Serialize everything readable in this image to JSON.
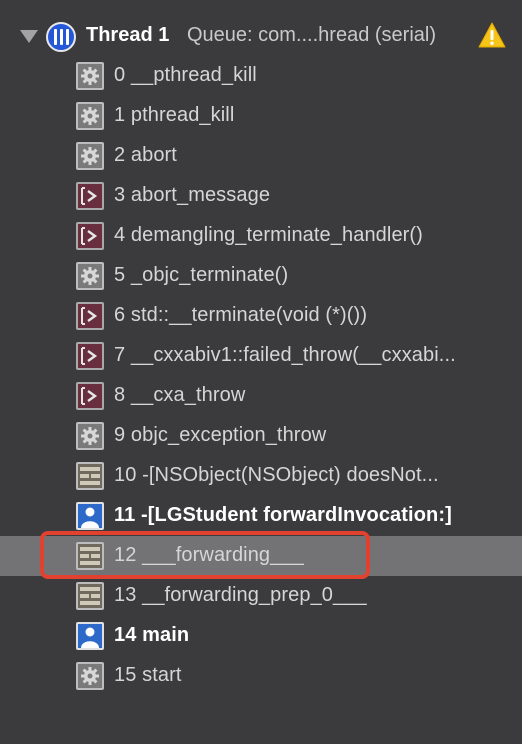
{
  "thread": {
    "title": "Thread 1",
    "queue": "Queue: com....hread (serial)",
    "icon": "thread-icon",
    "warning_icon": "warning-icon",
    "colors": {
      "thread_icon": "#2458d8",
      "warning": "#f5c518"
    }
  },
  "frames": [
    {
      "label": "0 __pthread_kill",
      "icon": "gear-icon"
    },
    {
      "label": "1 pthread_kill",
      "icon": "gear-icon"
    },
    {
      "label": "2 abort",
      "icon": "gear-icon"
    },
    {
      "label": "3 abort_message",
      "icon": "terminal-icon"
    },
    {
      "label": "4 demangling_terminate_handler()",
      "icon": "terminal-icon"
    },
    {
      "label": "5 _objc_terminate()",
      "icon": "gear-icon"
    },
    {
      "label": "6 std::__terminate(void (*)())",
      "icon": "terminal-icon"
    },
    {
      "label": "7 __cxxabiv1::failed_throw(__cxxabi...",
      "icon": "terminal-icon"
    },
    {
      "label": "8 __cxa_throw",
      "icon": "terminal-icon"
    },
    {
      "label": "9 objc_exception_throw",
      "icon": "gear-icon"
    },
    {
      "label": "10 -[NSObject(NSObject) doesNot...",
      "icon": "framework-icon"
    },
    {
      "label": "11 -[LGStudent forwardInvocation:]",
      "icon": "user-code-icon"
    },
    {
      "label": "12 ___forwarding___",
      "icon": "framework-icon"
    },
    {
      "label": "13 __forwarding_prep_0___",
      "icon": "framework-icon"
    },
    {
      "label": "14 main",
      "icon": "user-code-icon"
    },
    {
      "label": "15 start",
      "icon": "gear-icon"
    }
  ],
  "selected_frame": "12 ___forwarding___",
  "annotation_color": "#e0422f"
}
